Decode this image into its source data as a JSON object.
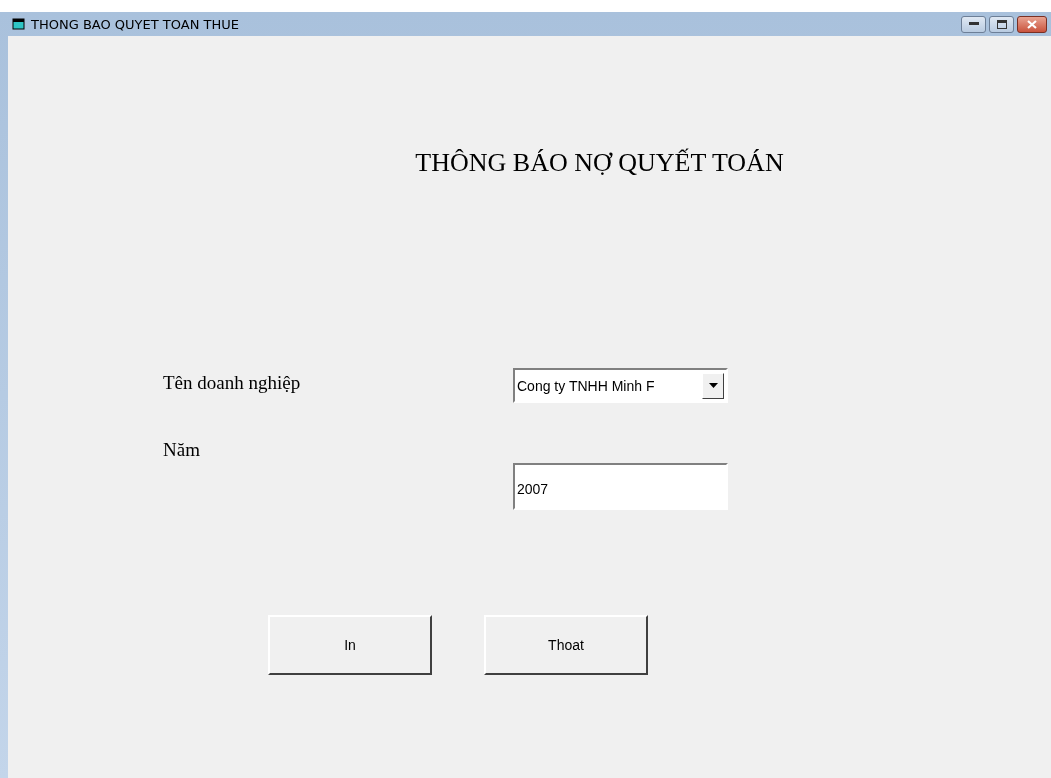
{
  "window": {
    "title": "THONG BAO QUYET TOAN THUE"
  },
  "heading": "THÔNG BÁO NỢ QUYẾT TOÁN",
  "fields": [
    {
      "kind": "combo",
      "label": "Tên doanh nghiệp",
      "value": "Cong ty TNHH Minh F"
    },
    {
      "kind": "text",
      "label": "Năm",
      "value": "2007"
    }
  ],
  "buttons": [
    "In",
    "Thoat"
  ]
}
